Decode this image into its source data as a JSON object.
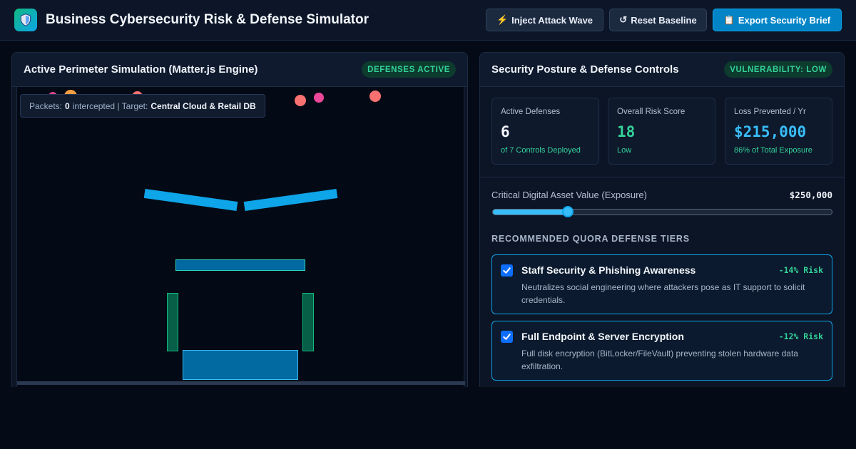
{
  "header": {
    "logo_icon": "shield-icon",
    "title": "Business Cybersecurity Risk & Defense Simulator",
    "buttons": {
      "inject": {
        "icon": "⚡",
        "label": "Inject Attack Wave"
      },
      "reset": {
        "icon": "↺",
        "label": "Reset Baseline"
      },
      "export": {
        "icon": "📋",
        "label": "Export Security Brief"
      }
    }
  },
  "simulation": {
    "title": "Active Perimeter Simulation (Matter.js Engine)",
    "status_badge": "DEFENSES ACTIVE",
    "hud": {
      "packets_prefix": "Packets:",
      "intercepted_count": "0",
      "intercepted_suffix": "intercepted | Target:",
      "target": "Central Cloud & Retail DB"
    }
  },
  "controls": {
    "title": "Security Posture & Defense Controls",
    "vulnerability_badge": "VULNERABILITY: LOW",
    "stats": {
      "active_defenses": {
        "label": "Active Defenses",
        "value": "6",
        "sub": "of 7 Controls Deployed"
      },
      "risk_score": {
        "label": "Overall Risk Score",
        "value": "18",
        "sub": "Low"
      },
      "loss_prevented": {
        "label": "Loss Prevented / Yr",
        "value": "$215,000",
        "sub": "86% of Total Exposure"
      }
    },
    "asset": {
      "label": "Critical Digital Asset Value (Exposure)",
      "value": "$250,000",
      "slider_fraction": 0.22
    },
    "tiers_heading": "RECOMMENDED QUORA DEFENSE TIERS",
    "tiers": [
      {
        "checked": true,
        "name": "Staff Security & Phishing Awareness",
        "risk": "-14% Risk",
        "description": "Neutralizes social engineering where attackers pose as IT support to solicit credentials."
      },
      {
        "checked": true,
        "name": "Full Endpoint & Server Encryption",
        "risk": "-12% Risk",
        "description": "Full disk encryption (BitLocker/FileVault) preventing stolen hardware data exfiltration."
      }
    ]
  },
  "colors": {
    "accent": "#0ea5e9",
    "success": "#34d399",
    "background": "#050b16"
  }
}
